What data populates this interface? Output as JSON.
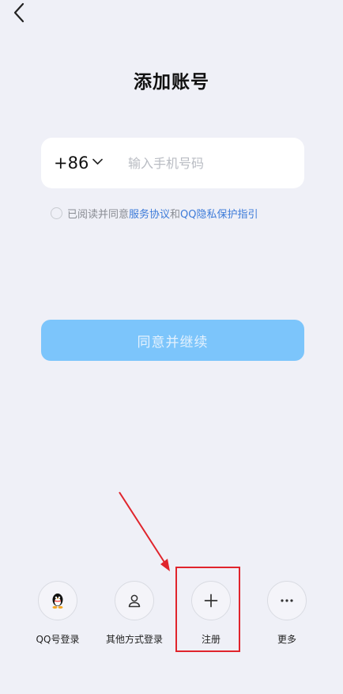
{
  "header": {
    "back_icon": "chevron-left-icon",
    "title": "添加账号"
  },
  "phone": {
    "country_code": "+86",
    "placeholder": "输入手机号码",
    "value": ""
  },
  "agreement": {
    "prefix": "已阅读并同意",
    "service_link": "服务协议",
    "conjunction": "和",
    "privacy_link": "QQ隐私保护指引"
  },
  "continue_button": {
    "label": "同意并继续"
  },
  "login_options": [
    {
      "label": "QQ号登录",
      "icon": "qq-penguin-icon"
    },
    {
      "label": "其他方式登录",
      "icon": "person-icon"
    },
    {
      "label": "注册",
      "icon": "plus-icon"
    },
    {
      "label": "更多",
      "icon": "ellipsis-icon"
    }
  ],
  "colors": {
    "accent": "#7cc5fb",
    "link": "#3d7bd9",
    "highlight": "#e0242c",
    "background": "#eff0f7"
  }
}
